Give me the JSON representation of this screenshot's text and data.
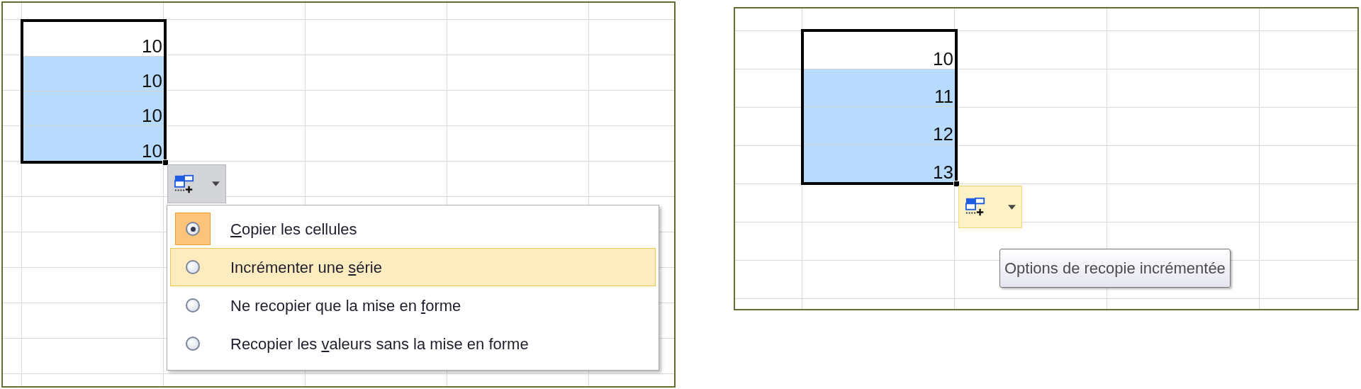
{
  "panels": [
    {
      "cells": [
        {
          "value": "10",
          "selected": false
        },
        {
          "value": "10",
          "selected": true
        },
        {
          "value": "10",
          "selected": true
        },
        {
          "value": "10",
          "selected": true
        }
      ],
      "smart_tag": {
        "hovered": false
      },
      "menu": {
        "items": [
          {
            "label_parts": {
              "key": "C",
              "after": "opier les cellules"
            },
            "selected": true,
            "highlighted": false
          },
          {
            "label_parts": {
              "before": "Incrémenter une ",
              "key": "s",
              "after": "érie"
            },
            "selected": false,
            "highlighted": true
          },
          {
            "label_parts": {
              "before": "Ne recopier que la mise en ",
              "key": "f",
              "after": "orme"
            },
            "selected": false,
            "highlighted": false
          },
          {
            "label_parts": {
              "before": "Recopier les ",
              "key": "v",
              "after": "aleurs sans la mise en forme"
            },
            "selected": false,
            "highlighted": false
          }
        ]
      }
    },
    {
      "cells": [
        {
          "value": "10",
          "selected": false
        },
        {
          "value": "11",
          "selected": true
        },
        {
          "value": "12",
          "selected": true
        },
        {
          "value": "13",
          "selected": true
        }
      ],
      "smart_tag": {
        "hovered": true
      },
      "tooltip": "Options de recopie incrémentée"
    }
  ]
}
